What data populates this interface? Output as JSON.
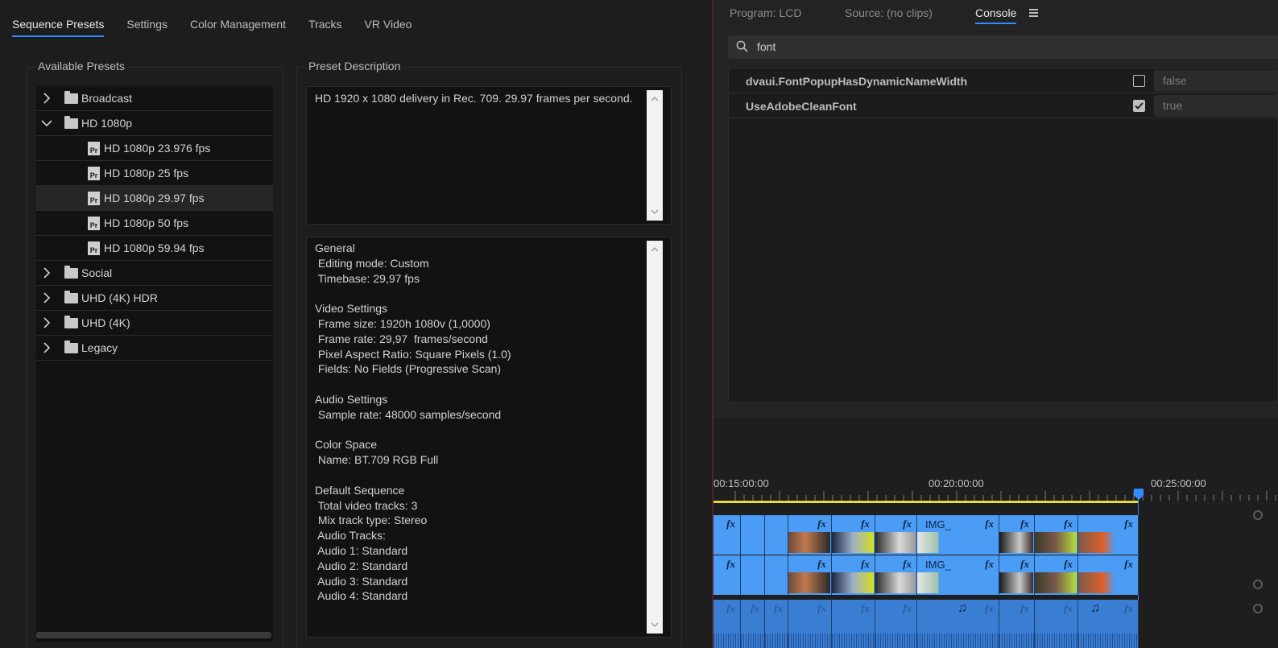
{
  "dialog": {
    "tabs": [
      "Sequence Presets",
      "Settings",
      "Color Management",
      "Tracks",
      "VR Video"
    ],
    "available_presets_title": "Available Presets",
    "preset_description_title": "Preset Description",
    "tree": [
      {
        "label": "Broadcast",
        "type": "folder",
        "expanded": false
      },
      {
        "label": "HD 1080p",
        "type": "folder",
        "expanded": true
      },
      {
        "label": "HD 1080p 23.976 fps",
        "type": "preset",
        "icon": "Pr"
      },
      {
        "label": "HD 1080p 25 fps",
        "type": "preset",
        "icon": "Pr"
      },
      {
        "label": "HD 1080p 29.97 fps",
        "type": "preset",
        "icon": "Pr",
        "selected": true
      },
      {
        "label": "HD 1080p 50 fps",
        "type": "preset",
        "icon": "Pr"
      },
      {
        "label": "HD 1080p 59.94 fps",
        "type": "preset",
        "icon": "Pr"
      },
      {
        "label": "Social",
        "type": "folder",
        "expanded": false
      },
      {
        "label": "UHD (4K) HDR",
        "type": "folder",
        "expanded": false
      },
      {
        "label": "UHD (4K)",
        "type": "folder",
        "expanded": false
      },
      {
        "label": "Legacy",
        "type": "folder",
        "expanded": false
      }
    ],
    "description": "HD 1920 x 1080 delivery in Rec. 709. 29.97 frames per second.",
    "info": [
      "General",
      " Editing mode: Custom",
      " Timebase: 29,97 fps",
      "",
      "Video Settings",
      " Frame size: 1920h 1080v (1,0000)",
      " Frame rate: 29,97  frames/second",
      " Pixel Aspect Ratio: Square Pixels (1.0)",
      " Fields: No Fields (Progressive Scan)",
      "",
      "Audio Settings",
      " Sample rate: 48000 samples/second",
      "",
      "Color Space",
      " Name: BT.709 RGB Full",
      "",
      "Default Sequence",
      " Total video tracks: 3",
      " Mix track type: Stereo",
      " Audio Tracks:",
      " Audio 1: Standard",
      " Audio 2: Standard",
      " Audio 3: Standard",
      " Audio 4: Standard"
    ]
  },
  "console_panel": {
    "tabs": {
      "program": "Program: LCD",
      "source": "Source: (no clips)",
      "console": "Console"
    },
    "search": {
      "value": "font"
    },
    "properties": [
      {
        "name": "dvaui.FontPopupHasDynamicNameWidth",
        "checked": false,
        "value": "false"
      },
      {
        "name": "UseAdobeCleanFont",
        "checked": true,
        "value": "true"
      }
    ]
  },
  "timeline": {
    "timecodes": [
      "00:15:00:00",
      "00:20:00:00",
      "00:25:00:00"
    ],
    "clip_label": "IMG_",
    "colors": {
      "clip": "#4b9cf5",
      "audio_clip": "#3a7ed4",
      "playhead": "#2f8cff",
      "work_area": "#e8d93a"
    }
  }
}
